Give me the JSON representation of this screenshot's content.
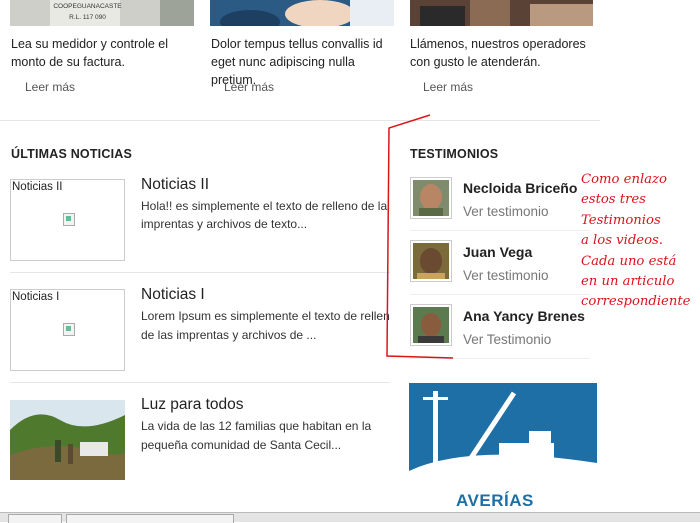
{
  "features": [
    {
      "text": "Lea su medidor y controle el monto de su factura.",
      "link": "Leer más",
      "meter_text": "COOPEGUANACASTE R.L. 117 090"
    },
    {
      "text": "Dolor tempus tellus convallis id eget nunc adipiscing nulla pretium.",
      "link": "Leer más"
    },
    {
      "text": "Llámenos, nuestros operadores con gusto le atenderán.",
      "link": "Leer más"
    }
  ],
  "news": {
    "title": "ÚLTIMAS NOTICIAS",
    "items": [
      {
        "thumb_alt": "Noticias II",
        "title": "Noticias II",
        "body_l1": "Hola!! es simplemente el texto de relleno de las",
        "body_l2": "imprentas y archivos de texto..."
      },
      {
        "thumb_alt": "Noticias I",
        "title": "Noticias I",
        "body_l1": "Lorem Ipsum es simplemente el texto de relleno",
        "body_l2": "de las imprentas y archivos de ..."
      },
      {
        "title": "Luz para todos",
        "body_l1": "La vida de las 12 familias que habitan en la",
        "body_l2": "pequeña comunidad de Santa Cecil..."
      }
    ]
  },
  "testimonials": {
    "title": "TESTIMONIOS",
    "items": [
      {
        "name": "Necloida Briceño",
        "link": "Ver testimonio"
      },
      {
        "name": "Juan Vega",
        "link": "Ver testimonio"
      },
      {
        "name": "Ana Yancy Brenes",
        "link": "Ver Testimonio"
      }
    ]
  },
  "banner": {
    "label": "AVERÍAS"
  },
  "annotation": "Como enlazo\nestos tres\nTestimonios\na los videos.\nCada uno está\nen un articulo\ncorrespondiente",
  "colors": {
    "annotation": "#d8151b",
    "banner": "#1e6fa5",
    "text": "#222222",
    "muted": "#777777"
  }
}
